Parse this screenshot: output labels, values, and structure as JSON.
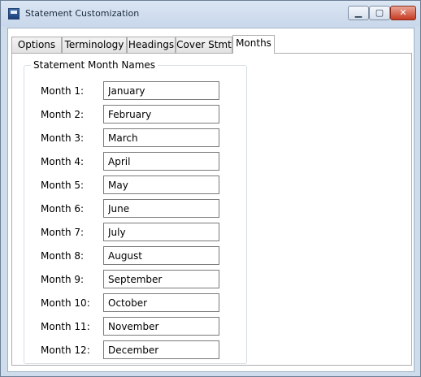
{
  "window": {
    "title": "Statement Customization"
  },
  "tabs": [
    {
      "label": "Options"
    },
    {
      "label": "Terminology"
    },
    {
      "label": "Headings"
    },
    {
      "label": "Cover Stmt"
    },
    {
      "label": "Months"
    }
  ],
  "active_tab": "Months",
  "group": {
    "title": "Statement Month Names"
  },
  "months": [
    {
      "label": "Month 1:",
      "value": "January"
    },
    {
      "label": "Month 2:",
      "value": "February"
    },
    {
      "label": "Month 3:",
      "value": "March"
    },
    {
      "label": "Month 4:",
      "value": "April"
    },
    {
      "label": "Month 5:",
      "value": "May"
    },
    {
      "label": "Month 6:",
      "value": "June"
    },
    {
      "label": "Month 7:",
      "value": "July"
    },
    {
      "label": "Month 8:",
      "value": "August"
    },
    {
      "label": "Month 9:",
      "value": "September"
    },
    {
      "label": "Month 10:",
      "value": "October"
    },
    {
      "label": "Month 11:",
      "value": "November"
    },
    {
      "label": "Month 12:",
      "value": "December"
    }
  ]
}
